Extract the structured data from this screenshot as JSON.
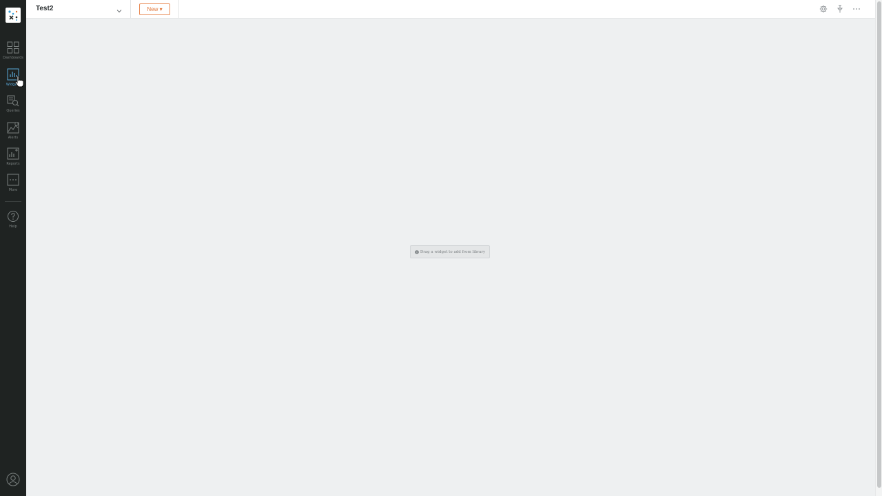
{
  "sidebar": {
    "items": [
      {
        "label": "Dashboards",
        "icon": "dashboards-icon"
      },
      {
        "label": "Widgets",
        "icon": "widgets-icon"
      },
      {
        "label": "Queries",
        "icon": "queries-icon"
      },
      {
        "label": "Alerts",
        "icon": "alerts-icon"
      },
      {
        "label": "Reports",
        "icon": "reports-icon"
      },
      {
        "label": "More",
        "icon": "more-icon"
      },
      {
        "label": "Help",
        "icon": "help-icon"
      }
    ]
  },
  "header": {
    "dashboard_title": "Test2",
    "new_button_label": "New ▾"
  },
  "canvas": {
    "empty_hint": "Drag a widget to add from library"
  },
  "colors": {
    "sidebar_bg": "#1f2322",
    "accent_orange": "#e0763a",
    "active_blue": "#5aa8d8",
    "canvas_bg": "#eef0f1"
  }
}
